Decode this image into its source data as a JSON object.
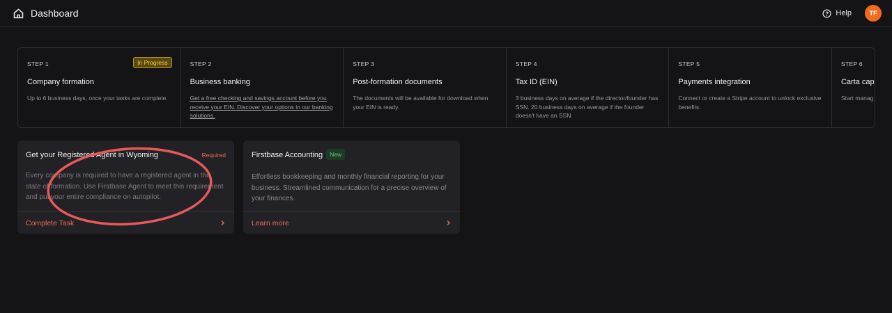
{
  "header": {
    "title": "Dashboard",
    "help_label": "Help",
    "avatar_initials": "TF",
    "icons": [
      "home-icon",
      "help-icon"
    ]
  },
  "steps": [
    {
      "label": "STEP 1",
      "title": "Company formation",
      "description": "Up to 6 business days, once your tasks are complete.",
      "status": "In Progress"
    },
    {
      "label": "STEP 2",
      "title": "Business banking",
      "description": "Get a free checking and savings account before you receive your EIN. Discover your options in our banking solutions."
    },
    {
      "label": "STEP 3",
      "title": "Post-formation documents",
      "description": "The documents will be available for download when your EIN is ready."
    },
    {
      "label": "STEP 4",
      "title": "Tax ID (EIN)",
      "description": "3 business days on average if the director/founder has SSN. 20 business days on average if the founder doesn't have an SSN."
    },
    {
      "label": "STEP 5",
      "title": "Payments integration",
      "description": "Connect or create a Stripe account to unlock exclusive benefits."
    },
    {
      "label": "STEP 6",
      "title": "Carta cap",
      "description": "Start manag setting up yo"
    }
  ],
  "cards": [
    {
      "title": "Get your Registered Agent in Wyoming",
      "badge": "Required",
      "body": "Every company is required to have a registered agent in the state of formation. Use Firstbase Agent to meet this requirement and put your entire compliance on autopilot.",
      "action": "Complete Task"
    },
    {
      "title": "Firstbase Accounting",
      "badge": "New",
      "body": "Effortless bookkeeping and monthly financial reporting for your business. Streamlined communication for a precise overview of your finances.",
      "action": "Learn more"
    }
  ],
  "colors": {
    "background": "#141416",
    "accent": "#ef6a59",
    "avatar": "#f26b1d",
    "in_progress": "#f2cf3c",
    "new_badge": "#5fd17c",
    "annotation": "#e8595a"
  }
}
